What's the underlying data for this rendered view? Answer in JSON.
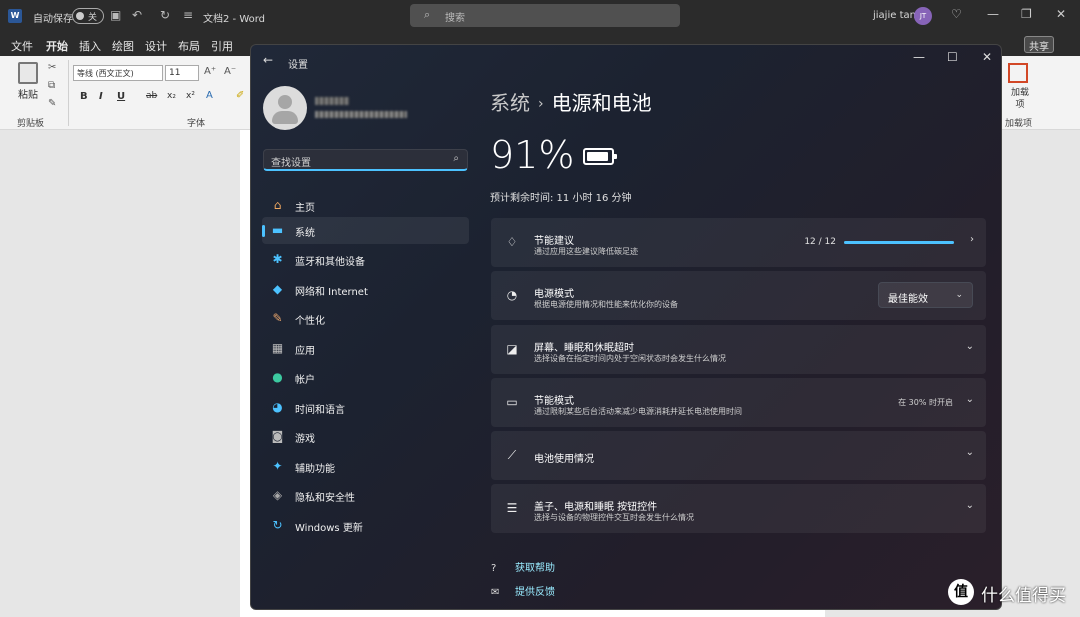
{
  "word": {
    "autosave_label": "自动保存",
    "autosave_state": "关",
    "doc_title": "文档2 - Word",
    "search_placeholder": "搜索",
    "user_name": "jiajie tan",
    "user_initials": "JT",
    "menu": [
      "文件",
      "开始",
      "插入",
      "绘图",
      "设计",
      "布局",
      "引用"
    ],
    "menu_active": "开始",
    "share_label": "共享",
    "ribbon": {
      "paste_label": "粘贴",
      "clipboard_group": "剪贴板",
      "font_name": "等线 (西文正文)",
      "font_size": "11",
      "font_group": "字体",
      "addin_label": "加载项",
      "addin_group": "加载项",
      "format_buttons": [
        "B",
        "I",
        "U",
        "ab",
        "x₂",
        "x²"
      ]
    }
  },
  "settings": {
    "window_title": "设置",
    "search_placeholder": "查找设置",
    "nav": [
      {
        "label": "主页",
        "icon": "home-icon",
        "glyph": "⌂",
        "color": "#f0a860"
      },
      {
        "label": "系统",
        "icon": "monitor-icon",
        "glyph": "▬",
        "color": "#4cc2ff",
        "active": true
      },
      {
        "label": "蓝牙和其他设备",
        "icon": "bluetooth-icon",
        "glyph": "✱",
        "color": "#4cc2ff"
      },
      {
        "label": "网络和 Internet",
        "icon": "wifi-icon",
        "glyph": "◆",
        "color": "#4cc2ff"
      },
      {
        "label": "个性化",
        "icon": "brush-icon",
        "glyph": "✎",
        "color": "#e8a46c"
      },
      {
        "label": "应用",
        "icon": "apps-icon",
        "glyph": "▦",
        "color": "#bbbbbb"
      },
      {
        "label": "帐户",
        "icon": "person-icon",
        "glyph": "●",
        "color": "#3cc9a0"
      },
      {
        "label": "时间和语言",
        "icon": "globe-icon",
        "glyph": "◕",
        "color": "#4cc2ff"
      },
      {
        "label": "游戏",
        "icon": "gamepad-icon",
        "glyph": "◙",
        "color": "#bbbbbb"
      },
      {
        "label": "辅助功能",
        "icon": "accessibility-icon",
        "glyph": "✦",
        "color": "#4cc2ff"
      },
      {
        "label": "隐私和安全性",
        "icon": "shield-icon",
        "glyph": "◈",
        "color": "#aaaaaa"
      },
      {
        "label": "Windows 更新",
        "icon": "update-icon",
        "glyph": "↻",
        "color": "#4cc2ff"
      }
    ],
    "breadcrumb": {
      "parent": "系统",
      "current": "电源和电池"
    },
    "battery": {
      "percent_text": "91%",
      "level": 0.91,
      "remaining": "预计剩余时间: 11 小时 16 分钟"
    },
    "cards": [
      {
        "title": "节能建议",
        "subtitle": "通过应用这些建议降低碳足迹",
        "icon": "leaf-icon",
        "glyph": "♢",
        "progress_text": "12 / 12",
        "progress": 1.0,
        "chevron": "›"
      },
      {
        "title": "电源模式",
        "subtitle": "根据电源使用情况和性能来优化你的设备",
        "icon": "power-mode-icon",
        "glyph": "◔",
        "dropdown": "最佳能效"
      },
      {
        "title": "屏幕、睡眠和休眠超时",
        "subtitle": "选择设备在指定时间内处于空闲状态时会发生什么情况",
        "icon": "screen-sleep-icon",
        "glyph": "◪",
        "chevron": "⌄"
      },
      {
        "title": "节能模式",
        "subtitle": "通过限制某些后台活动来减少电源消耗并延长电池使用时间",
        "icon": "battery-saver-icon",
        "glyph": "▭",
        "note": "在 30% 时开启",
        "chevron": "⌄"
      },
      {
        "title": "电池使用情况",
        "subtitle": "",
        "icon": "chart-icon",
        "glyph": "⟋",
        "chevron": "⌄"
      },
      {
        "title": "盖子、电源和睡眠 按钮控件",
        "subtitle": "选择与设备的物理控件交互时会发生什么情况",
        "icon": "list-icon",
        "glyph": "☰",
        "chevron": "⌄"
      }
    ],
    "links": [
      {
        "label": "获取帮助",
        "icon": "help-icon",
        "glyph": "?"
      },
      {
        "label": "提供反馈",
        "icon": "feedback-icon",
        "glyph": "✉"
      }
    ]
  },
  "watermark": {
    "symbol": "值",
    "text": "什么值得买"
  }
}
